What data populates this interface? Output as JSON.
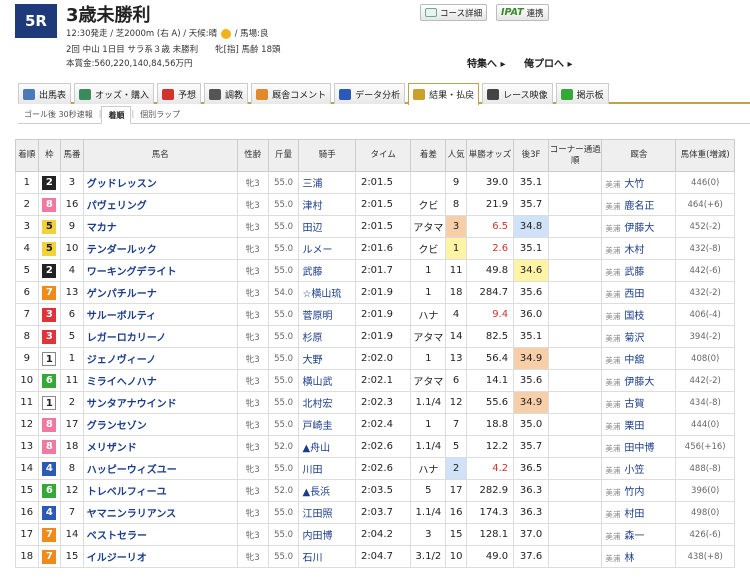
{
  "race": {
    "number": "5R",
    "name": "3歳未勝利",
    "info1_a": "12:30発走 / 芝2000m (右 A) / 天候:晴",
    "info1_b": "/ 馬場:良",
    "info2": "2回 中山 1日目 サラ系３歳 未勝利　　牝[指] 馬齢 18頭",
    "info3": "本賞金:560,220,140,84,56万円"
  },
  "buttons": {
    "course": "コース詳細",
    "ipat": "IPAT",
    "ipat_suffix": "連携"
  },
  "links": {
    "tokusyu": "特集へ",
    "oreporo": "俺プロへ"
  },
  "icons": {
    "sun": "sun-icon",
    "arrow": "▸"
  },
  "tabs": [
    "出馬表",
    "オッズ・購入",
    "予想",
    "調教",
    "厩舎コメント",
    "データ分析",
    "結果・払戻",
    "レース映像",
    "掲示板"
  ],
  "active_tab": "結果・払戻",
  "subtabs": [
    "ゴール後 30秒速報",
    "着順",
    "個別ラップ"
  ],
  "columns": [
    "着順",
    "枠",
    "馬番",
    "馬名",
    "性齢",
    "斤量",
    "騎手",
    "タイム",
    "着差",
    "人気",
    "単勝オッズ",
    "後3F",
    "コーナー通過順",
    "厩舎",
    "馬体重(増減)"
  ],
  "rows": [
    {
      "rank": "1",
      "frame": "2",
      "num": "3",
      "name": "グッドレッスン",
      "sex": "牝3",
      "kg": "55.0",
      "jockey": "三浦",
      "time": "2:01.5",
      "margin": "",
      "pop": "9",
      "odds": "39.0",
      "l3f": "35.1",
      "corner": "",
      "loc": "美浦",
      "trainer": "大竹",
      "weight": "446(0)"
    },
    {
      "rank": "2",
      "frame": "8",
      "num": "16",
      "name": "パヴェリング",
      "sex": "牝3",
      "kg": "55.0",
      "jockey": "津村",
      "time": "2:01.5",
      "margin": "クビ",
      "pop": "8",
      "odds": "21.9",
      "l3f": "35.7",
      "corner": "",
      "loc": "美浦",
      "trainer": "鹿名正",
      "weight": "464(+6)"
    },
    {
      "rank": "3",
      "frame": "5",
      "num": "9",
      "name": "マカナ",
      "sex": "牝3",
      "kg": "55.0",
      "jockey": "田辺",
      "time": "2:01.5",
      "margin": "アタマ",
      "pop": "3",
      "odds": "6.5",
      "l3f": "34.8",
      "corner": "",
      "loc": "美浦",
      "trainer": "伊藤大",
      "weight": "452(-2)"
    },
    {
      "rank": "4",
      "frame": "5",
      "num": "10",
      "name": "テンダールック",
      "sex": "牝3",
      "kg": "55.0",
      "jockey": "ルメー",
      "time": "2:01.6",
      "margin": "クビ",
      "pop": "1",
      "odds": "2.6",
      "l3f": "35.1",
      "corner": "",
      "loc": "美浦",
      "trainer": "木村",
      "weight": "432(-8)"
    },
    {
      "rank": "5",
      "frame": "2",
      "num": "4",
      "name": "ワーキングデライト",
      "sex": "牝3",
      "kg": "55.0",
      "jockey": "武藤",
      "time": "2:01.7",
      "margin": "1",
      "pop": "11",
      "odds": "49.8",
      "l3f": "34.6",
      "corner": "",
      "loc": "美浦",
      "trainer": "武藤",
      "weight": "442(-6)"
    },
    {
      "rank": "6",
      "frame": "7",
      "num": "13",
      "name": "ゲンパチルーナ",
      "sex": "牝3",
      "kg": "54.0",
      "jockey": "☆横山琉",
      "time": "2:01.9",
      "margin": "1",
      "pop": "18",
      "odds": "284.7",
      "l3f": "35.6",
      "corner": "",
      "loc": "美浦",
      "trainer": "西田",
      "weight": "432(-2)"
    },
    {
      "rank": "7",
      "frame": "3",
      "num": "6",
      "name": "サルーボルティ",
      "sex": "牝3",
      "kg": "55.0",
      "jockey": "菅原明",
      "time": "2:01.9",
      "margin": "ハナ",
      "pop": "4",
      "odds": "9.4",
      "l3f": "36.0",
      "corner": "",
      "loc": "美浦",
      "trainer": "国枝",
      "weight": "406(-4)"
    },
    {
      "rank": "8",
      "frame": "3",
      "num": "5",
      "name": "レガーロカリーノ",
      "sex": "牝3",
      "kg": "55.0",
      "jockey": "杉原",
      "time": "2:01.9",
      "margin": "アタマ",
      "pop": "14",
      "odds": "82.5",
      "l3f": "35.1",
      "corner": "",
      "loc": "美浦",
      "trainer": "菊沢",
      "weight": "394(-2)"
    },
    {
      "rank": "9",
      "frame": "1",
      "num": "1",
      "name": "ジェノヴィーノ",
      "sex": "牝3",
      "kg": "55.0",
      "jockey": "大野",
      "time": "2:02.0",
      "margin": "1",
      "pop": "13",
      "odds": "56.4",
      "l3f": "34.9",
      "corner": "",
      "loc": "美浦",
      "trainer": "中舘",
      "weight": "408(0)"
    },
    {
      "rank": "10",
      "frame": "6",
      "num": "11",
      "name": "ミライヘノハナ",
      "sex": "牝3",
      "kg": "55.0",
      "jockey": "横山武",
      "time": "2:02.1",
      "margin": "アタマ",
      "pop": "6",
      "odds": "14.1",
      "l3f": "35.6",
      "corner": "",
      "loc": "美浦",
      "trainer": "伊藤大",
      "weight": "442(-2)"
    },
    {
      "rank": "11",
      "frame": "1",
      "num": "2",
      "name": "サンタアナウインド",
      "sex": "牝3",
      "kg": "55.0",
      "jockey": "北村宏",
      "time": "2:02.3",
      "margin": "1.1/4",
      "pop": "12",
      "odds": "55.6",
      "l3f": "34.9",
      "corner": "",
      "loc": "美浦",
      "trainer": "古賀",
      "weight": "434(-8)"
    },
    {
      "rank": "12",
      "frame": "8",
      "num": "17",
      "name": "グランセゾン",
      "sex": "牝3",
      "kg": "55.0",
      "jockey": "戸崎圭",
      "time": "2:02.4",
      "margin": "1",
      "pop": "7",
      "odds": "18.8",
      "l3f": "35.0",
      "corner": "",
      "loc": "美浦",
      "trainer": "栗田",
      "weight": "444(0)"
    },
    {
      "rank": "13",
      "frame": "8",
      "num": "18",
      "name": "メリザンド",
      "sex": "牝3",
      "kg": "52.0",
      "jockey": "▲舟山",
      "time": "2:02.6",
      "margin": "1.1/4",
      "pop": "5",
      "odds": "12.2",
      "l3f": "35.7",
      "corner": "",
      "loc": "美浦",
      "trainer": "田中博",
      "weight": "456(+16)"
    },
    {
      "rank": "14",
      "frame": "4",
      "num": "8",
      "name": "ハッピーウィズユー",
      "sex": "牝3",
      "kg": "55.0",
      "jockey": "川田",
      "time": "2:02.6",
      "margin": "ハナ",
      "pop": "2",
      "odds": "4.2",
      "l3f": "36.5",
      "corner": "",
      "loc": "美浦",
      "trainer": "小笠",
      "weight": "488(-8)"
    },
    {
      "rank": "15",
      "frame": "6",
      "num": "12",
      "name": "トレベルフィーユ",
      "sex": "牝3",
      "kg": "52.0",
      "jockey": "▲長浜",
      "time": "2:03.5",
      "margin": "5",
      "pop": "17",
      "odds": "282.9",
      "l3f": "36.3",
      "corner": "",
      "loc": "美浦",
      "trainer": "竹内",
      "weight": "396(0)"
    },
    {
      "rank": "16",
      "frame": "4",
      "num": "7",
      "name": "ヤマニンラリアンス",
      "sex": "牝3",
      "kg": "55.0",
      "jockey": "江田照",
      "time": "2:03.7",
      "margin": "1.1/4",
      "pop": "16",
      "odds": "174.3",
      "l3f": "36.3",
      "corner": "",
      "loc": "美浦",
      "trainer": "村田",
      "weight": "498(0)"
    },
    {
      "rank": "17",
      "frame": "7",
      "num": "14",
      "name": "ベストセラー",
      "sex": "牝3",
      "kg": "55.0",
      "jockey": "内田博",
      "time": "2:04.2",
      "margin": "3",
      "pop": "15",
      "odds": "128.1",
      "l3f": "37.0",
      "corner": "",
      "loc": "美浦",
      "trainer": "森一",
      "weight": "426(-6)"
    },
    {
      "rank": "18",
      "frame": "7",
      "num": "15",
      "name": "イルジーリオ",
      "sex": "牝3",
      "kg": "55.0",
      "jockey": "石川",
      "time": "2:04.7",
      "margin": "3.1/2",
      "pop": "10",
      "odds": "49.0",
      "l3f": "37.6",
      "corner": "",
      "loc": "美浦",
      "trainer": "林",
      "weight": "438(+8)"
    }
  ]
}
